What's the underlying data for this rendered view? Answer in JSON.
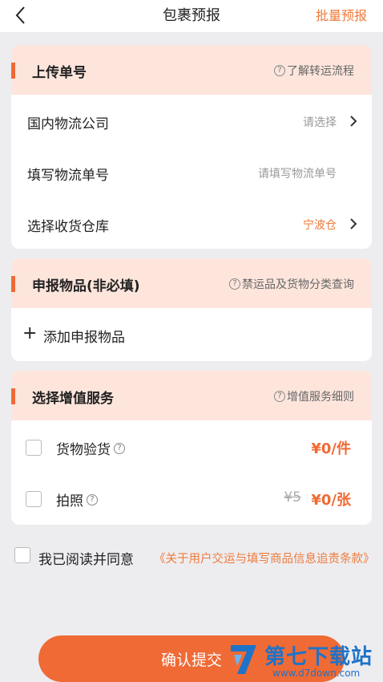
{
  "nav": {
    "title": "包裹预报",
    "batch_label": "批量预报"
  },
  "upload": {
    "title": "上传单号",
    "help": "了解转运流程",
    "rows": [
      {
        "label": "国内物流公司",
        "value": "请选择"
      },
      {
        "label": "填写物流单号",
        "value": "请填写物流单号"
      },
      {
        "label": "选择收货仓库",
        "value": "宁波仓"
      }
    ]
  },
  "declare": {
    "title": "申报物品(非必填)",
    "help": "禁运品及货物分类查询",
    "add_label": "添加申报物品"
  },
  "services": {
    "title": "选择增值服务",
    "help": "增值服务细则",
    "items": [
      {
        "label": "货物验货",
        "price": "¥0/件",
        "old_price": "",
        "checked": false
      },
      {
        "label": "拍照",
        "price": "¥0/张",
        "old_price": "¥5",
        "checked": false
      }
    ]
  },
  "agreement": {
    "text": "我已阅读并同意",
    "link": "《关于用户交运与填写商品信息追责条款》",
    "checked": false
  },
  "submit_label": "确认提交",
  "watermark": {
    "name": "第七下载站",
    "url": "www.d7down.com"
  },
  "colors": {
    "accent": "#ef6a35",
    "header_bg": "#fde5dc",
    "page_bg": "#ededf0"
  }
}
